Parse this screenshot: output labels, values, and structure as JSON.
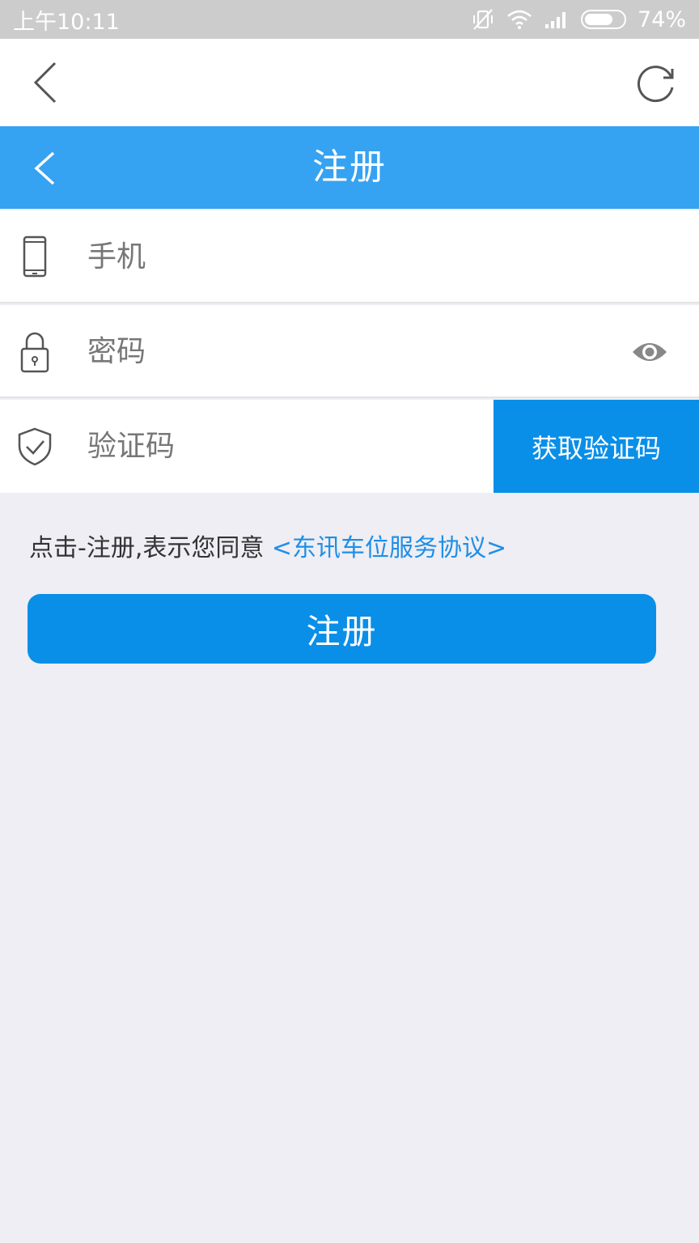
{
  "status_bar": {
    "time": "上午10:11",
    "battery": "74%",
    "battery_level": 0.74
  },
  "browser": {
    "back_icon": "chevron-left-icon",
    "reload_icon": "refresh-icon"
  },
  "header": {
    "title": "注册",
    "back_icon": "chevron-left-icon"
  },
  "form": {
    "phone_placeholder": "手机",
    "password_placeholder": "密码",
    "code_placeholder": "验证码",
    "get_code_label": "获取验证码"
  },
  "agreement": {
    "prefix": "点击-注册,表示您同意 ",
    "link": "<东讯车位服务协议>"
  },
  "submit_label": "注册",
  "colors": {
    "header_blue": "#36a2f2",
    "button_blue": "#0a8fe8",
    "link_blue": "#1f8fe6",
    "background": "#eeeef4"
  }
}
